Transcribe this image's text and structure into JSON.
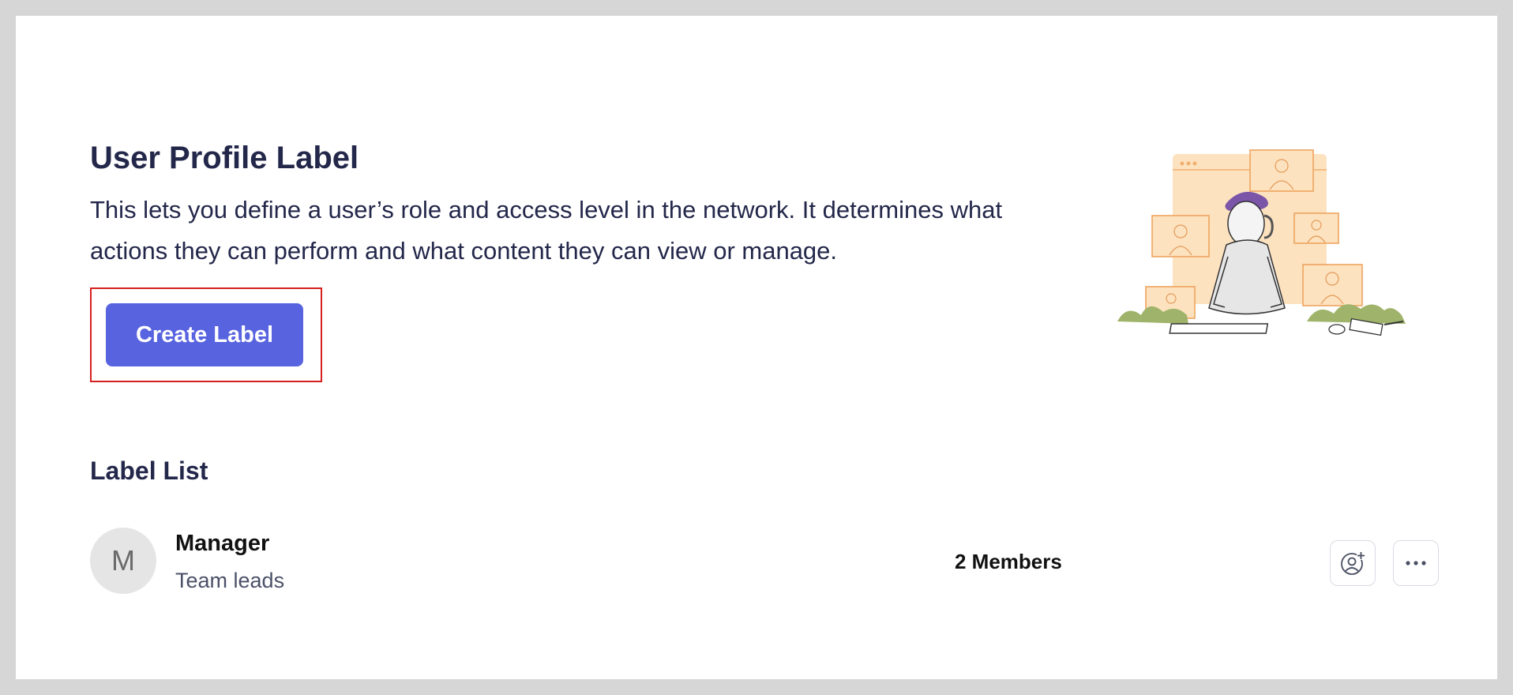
{
  "header": {
    "title": "User Profile Label",
    "description": "This lets you define a user’s role and access level in the network. It determines what actions they can perform and what content they can view or manage.",
    "create_button": "Create Label"
  },
  "label_list": {
    "title": "Label List",
    "items": [
      {
        "avatar_initial": "M",
        "name": "Manager",
        "subtitle": "Team leads",
        "members": "2 Members",
        "actions": [
          "add-user-icon",
          "more-icon"
        ]
      }
    ]
  },
  "colors": {
    "primary": "#5863e0",
    "heading": "#23274a",
    "highlight_border": "#d61f1f",
    "illustration_bg": "#fde2bf"
  }
}
